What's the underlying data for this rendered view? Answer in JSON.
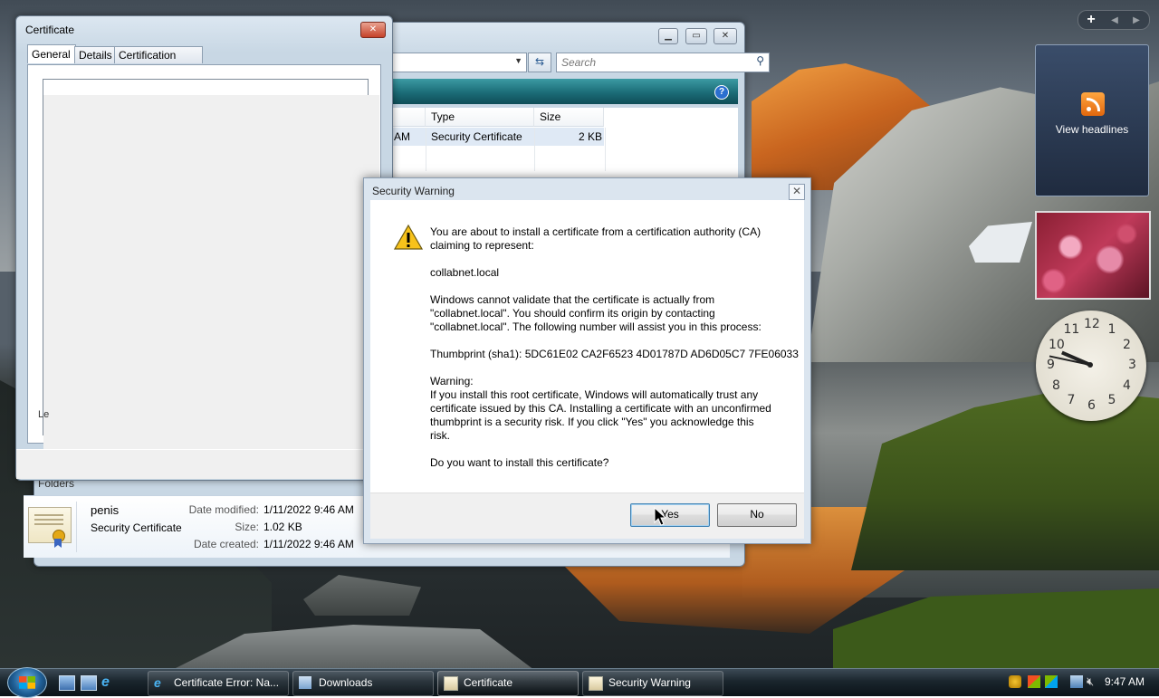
{
  "explorer": {
    "search_placeholder": "Search",
    "columns": [
      "Type",
      "Size"
    ],
    "row": {
      "date_fragment": "AM",
      "type": "Security Certificate",
      "size": "2 KB"
    },
    "folders_label": "Folders",
    "details": {
      "name": "penis",
      "type": "Security Certificate",
      "date_modified_label": "Date modified:",
      "date_modified": "1/11/2022 9:46 AM",
      "size_label": "Size:",
      "size": "1.02 KB",
      "date_created_label": "Date created:",
      "date_created": "1/11/2022 9:46 AM"
    }
  },
  "certificate_window": {
    "title": "Certificate",
    "tabs": [
      "General",
      "Details",
      "Certification Path"
    ],
    "fragment_text": "Le"
  },
  "security_warning": {
    "title": "Security Warning",
    "p1": "You are about to install a certificate from a certification authority (CA)\nclaiming to represent:",
    "p2": "collabnet.local",
    "p3": "Windows cannot validate that the certificate is actually from\n\"collabnet.local\". You should confirm its origin by contacting\n\"collabnet.local\". The following number will assist you in this process:",
    "p4": "Thumbprint (sha1): 5DC61E02 CA2F6523 4D01787D AD6D05C7 7FE06033",
    "p5": "Warning:\nIf you install this root certificate, Windows will automatically trust any\ncertificate issued by this CA. Installing a certificate with an unconfirmed\nthumbprint is a security risk. If you click \"Yes\" you acknowledge this\nrisk.",
    "p6": "Do you want to install this certificate?",
    "yes_label": "Yes",
    "no_label": "No"
  },
  "sidebar": {
    "feed_label": "View headlines",
    "clock_numbers": [
      "12",
      "1",
      "2",
      "3",
      "4",
      "5",
      "6",
      "7",
      "8",
      "9",
      "10",
      "11"
    ]
  },
  "taskbar": {
    "tasks": [
      {
        "label": "Certificate Error: Na..."
      },
      {
        "label": "Downloads"
      },
      {
        "label": "Certificate"
      },
      {
        "label": "Security Warning"
      }
    ],
    "time": "9:47 AM"
  }
}
